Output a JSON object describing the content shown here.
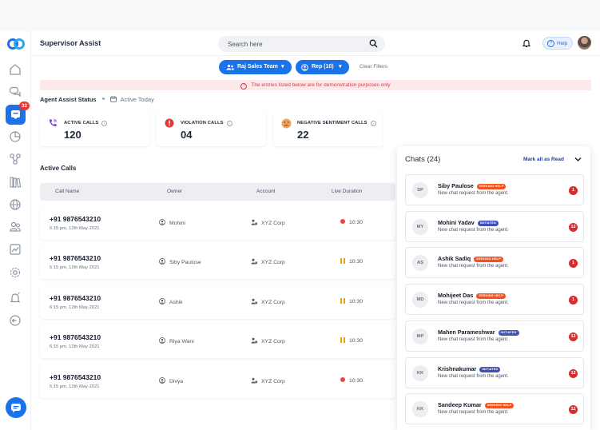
{
  "header": {
    "app_title": "Supervisor Assist",
    "search_placeholder": "Search here",
    "help_label": "Help"
  },
  "sidebar": {
    "badge_count": "32",
    "icons": [
      "home-icon",
      "chat-bubbles-icon",
      "agent-assist-icon",
      "analytics-icon",
      "network-icon",
      "library-icon",
      "globe-icon",
      "team-icon",
      "trend-icon",
      "settings-icon",
      "alerts-icon",
      "logout-icon",
      "chat-icon"
    ]
  },
  "filters": {
    "team_label": "Raj Sales Team",
    "rep_label": "Rep (10)",
    "clear_label": "Clear Filters"
  },
  "banner": {
    "text": "The entries listed below are for demonstration purposes only"
  },
  "status": {
    "title": "Agent Assist Status",
    "subtitle": "Active Today"
  },
  "stats": [
    {
      "label": "ACTIVE CALLS",
      "value": "120",
      "icon": "phone-icon",
      "color": "#7b3fe4"
    },
    {
      "label": "VIOLATION CALLS",
      "value": "04",
      "icon": "violation-icon",
      "color": "#e53935"
    },
    {
      "label": "NEGATIVE SENTIMENT CALLS",
      "value": "22",
      "icon": "sad-face-icon",
      "color": "#f5a25d"
    }
  ],
  "active_calls": {
    "title": "Active Calls",
    "columns": [
      "Call Name",
      "Owner",
      "Account",
      "Live Duration"
    ],
    "rows": [
      {
        "number": "+91 9876543210",
        "time": "6:15 pm, 12th May 2021",
        "owner": "Mohini",
        "account": "XYZ Corp",
        "duration": "10:30",
        "state": "recording"
      },
      {
        "number": "+91 9876543210",
        "time": "6:15 pm, 12th May 2021",
        "owner": "Siby Paulose",
        "account": "XYZ Corp",
        "duration": "10:30",
        "state": "paused"
      },
      {
        "number": "+91 9876543210",
        "time": "6:15 pm, 12th May 2021",
        "owner": "Ashik",
        "account": "XYZ Corp",
        "duration": "10:30",
        "state": "paused"
      },
      {
        "number": "+91 9876543210",
        "time": "6:15 pm, 12th May 2021",
        "owner": "Riya Wani",
        "account": "XYZ Corp",
        "duration": "10:30",
        "state": "paused"
      },
      {
        "number": "+91 9876543210",
        "time": "6:15 pm, 12th May 2021",
        "owner": "Divya",
        "account": "XYZ Corp",
        "duration": "10:30",
        "state": "recording"
      }
    ]
  },
  "chats": {
    "title": "Chats (24)",
    "mark_all_label": "Mark all as Read",
    "items": [
      {
        "initials": "SP",
        "name": "Siby Paulose",
        "tag": "SEEKING HELP",
        "tag_type": "seek",
        "message": "New chat request from the agent.",
        "count": "1"
      },
      {
        "initials": "MY",
        "name": "Mohini Yadav",
        "tag": "INITIATED",
        "tag_type": "init",
        "message": "New chat request from the agent.",
        "count": "12"
      },
      {
        "initials": "AS",
        "name": "Ashik Sadiq",
        "tag": "SEEKING HELP",
        "tag_type": "seek",
        "message": "New chat request from the agent.",
        "count": "1"
      },
      {
        "initials": "MD",
        "name": "Mohijeet Das",
        "tag": "SEEKING HELP",
        "tag_type": "seek",
        "message": "New chat request from the agent.",
        "count": "1"
      },
      {
        "initials": "MP",
        "name": "Mahen Parameshwar",
        "tag": "INITIATED",
        "tag_type": "init",
        "message": "New chat request from the agent.",
        "count": "12"
      },
      {
        "initials": "KK",
        "name": "Krishnakumar",
        "tag": "INITIATED",
        "tag_type": "init",
        "message": "New chat request from the agent.",
        "count": "12"
      },
      {
        "initials": "KK",
        "name": "Sandeep Kumar",
        "tag": "SEEKING HELP",
        "tag_type": "seek",
        "message": "New chat request from the agent.",
        "count": "12"
      }
    ]
  }
}
